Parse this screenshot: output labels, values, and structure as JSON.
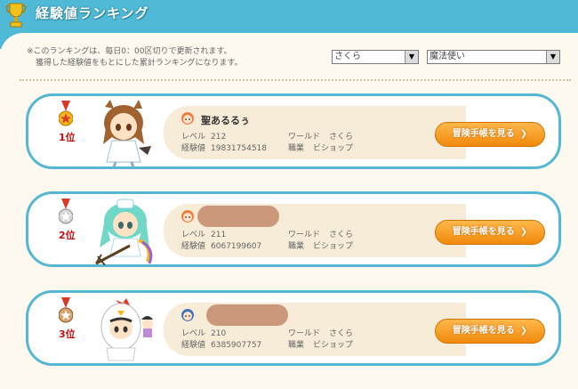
{
  "header": {
    "title": "経験値ランキング"
  },
  "notice": [
    "※このランキングは、毎日0：00区切りで更新されます。",
    "獲得した経験値をもとにした累計ランキングになります。"
  ],
  "filters": {
    "world": "さくら",
    "job": "魔法使い"
  },
  "labels": {
    "level": "レベル",
    "exp": "経験値",
    "world": "ワールド",
    "job": "職業",
    "button": "冒険手帳を見る"
  },
  "entries": [
    {
      "rank": "1位",
      "name": "聖あるるぅ",
      "level": "212",
      "exp": "19831754518",
      "world": "さくら",
      "job": "ビショップ"
    },
    {
      "rank": "2位",
      "name": "",
      "level": "211",
      "exp": "6067199607",
      "world": "さくら",
      "job": "ビショップ"
    },
    {
      "rank": "3位",
      "name": "",
      "level": "210",
      "exp": "6385907757",
      "world": "さくら",
      "job": "ビショップ"
    }
  ],
  "colors": {
    "header": "#4fb9d6",
    "panel": "#fdf9ee",
    "card_border": "#55b7d4",
    "rank": "#c20f0f",
    "button": "#f08a0d"
  },
  "icons": [
    "trophy-icon",
    "gold-medal-icon",
    "silver-medal-icon",
    "bronze-medal-icon",
    "user-face-icon",
    "chevron-right-icon"
  ]
}
